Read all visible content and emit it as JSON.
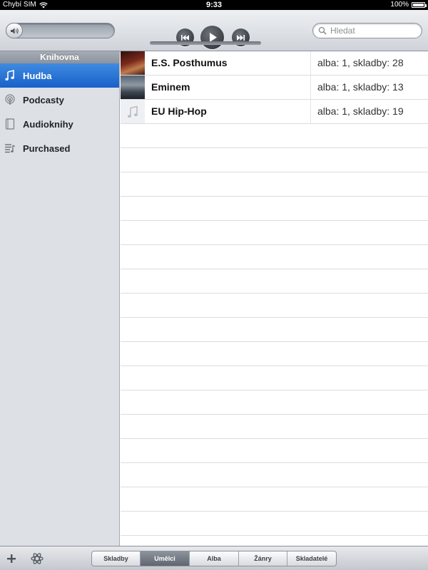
{
  "status_bar": {
    "carrier": "Chybí SIM",
    "time": "9:33",
    "battery": "100%"
  },
  "toolbar": {
    "search_placeholder": "Hledat"
  },
  "sidebar": {
    "header": "Knihovna",
    "items": [
      {
        "label": "Hudba",
        "icon": "music-note-icon",
        "selected": true
      },
      {
        "label": "Podcasty",
        "icon": "podcast-icon",
        "selected": false
      },
      {
        "label": "Audioknihy",
        "icon": "audiobook-icon",
        "selected": false
      },
      {
        "label": "Purchased",
        "icon": "playlist-icon",
        "selected": false
      }
    ]
  },
  "artists": [
    {
      "name": "E.S. Posthumus",
      "count": "alba: 1, skladby: 28"
    },
    {
      "name": "Eminem",
      "count": "alba: 1, skladby: 13"
    },
    {
      "name": "EU Hip-Hop",
      "count": "alba: 1, skladby: 19"
    }
  ],
  "bottom_bar": {
    "tabs": [
      {
        "label": "Skladby",
        "active": false
      },
      {
        "label": "Umělci",
        "active": true
      },
      {
        "label": "Alba",
        "active": false
      },
      {
        "label": "Žánry",
        "active": false
      },
      {
        "label": "Skladatelé",
        "active": false
      }
    ]
  },
  "colors": {
    "selection_blue": "#2a72d6",
    "sidebar_bg": "#dde1e6",
    "active_tab": "#707780"
  }
}
